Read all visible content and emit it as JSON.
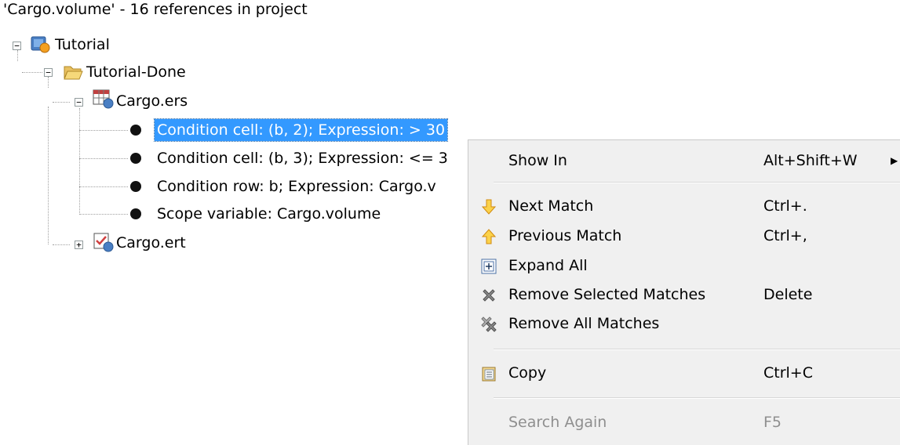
{
  "header": {
    "title": "'Cargo.volume' - 16 references in project"
  },
  "tree": {
    "root": {
      "label": "Tutorial"
    },
    "folder": {
      "label": "Tutorial-Done"
    },
    "ers_file": {
      "label": "Cargo.ers"
    },
    "matches": [
      {
        "label": "Condition cell: (b, 2); Expression: > 30"
      },
      {
        "label": "Condition cell: (b, 3); Expression: <= 3"
      },
      {
        "label": "Condition row: b; Expression: Cargo.v"
      },
      {
        "label": "Scope variable: Cargo.volume"
      }
    ],
    "ert_file": {
      "label": "Cargo.ert"
    }
  },
  "menu": {
    "show_in": {
      "label": "Show In",
      "shortcut": "Alt+Shift+W"
    },
    "next_match": {
      "label": "Next Match",
      "shortcut": "Ctrl+.",
      "icon": "arrow-down-icon"
    },
    "previous_match": {
      "label": "Previous Match",
      "shortcut": "Ctrl+,",
      "icon": "arrow-up-icon"
    },
    "expand_all": {
      "label": "Expand All",
      "icon": "expand-all-icon"
    },
    "remove_selected": {
      "label": "Remove Selected Matches",
      "shortcut": "Delete",
      "icon": "remove-x-icon"
    },
    "remove_all": {
      "label": "Remove All Matches",
      "icon": "remove-all-icon"
    },
    "copy": {
      "label": "Copy",
      "shortcut": "Ctrl+C",
      "icon": "copy-icon"
    },
    "search_again": {
      "label": "Search Again",
      "shortcut": "F5"
    }
  },
  "colors": {
    "selection": "#3399ff",
    "menu_bg": "#f0f0f0",
    "arrow_orange": "#f0a020"
  }
}
